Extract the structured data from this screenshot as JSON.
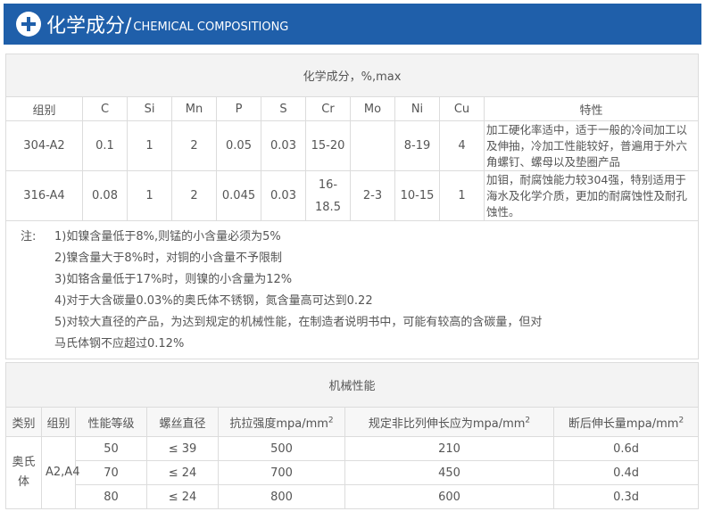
{
  "banner": {
    "title": "化学成分/",
    "subtitle": "CHEMICAL COMPOSITIONG"
  },
  "chemical": {
    "caption": "化学成分，%,max",
    "headers": [
      "组别",
      "C",
      "Si",
      "Mn",
      "P",
      "S",
      "Cr",
      "Mo",
      "Ni",
      "Cu",
      "特性"
    ],
    "rows": [
      {
        "group": "304-A2",
        "c": "0.1",
        "si": "1",
        "mn": "2",
        "p": "0.05",
        "s": "0.03",
        "cr": "15-20",
        "mo": "",
        "ni": "8-19",
        "cu": "4",
        "feature": "加工硬化率适中，适于一般的冷间加工以及伸抽，冷加工性能较好，普遍用于外六角螺钉、螺母以及垫圈产品"
      },
      {
        "group": "316-A4",
        "c": "0.08",
        "si": "1",
        "mn": "2",
        "p": "0.045",
        "s": "0.03",
        "cr_top": "16-",
        "cr_bottom": "18.5",
        "mo": "2-3",
        "ni": "10-15",
        "cu": "1",
        "feature": "加钼，耐腐蚀能力较304强，特别适用于海水及化学介质，更加的耐腐蚀性及耐孔蚀性。"
      }
    ],
    "notes_label": "注:",
    "notes": [
      "1)如镍含量低于8%,则锰的小含量必须为5%",
      "2)镍含量大于8%时，对铜的小含量不予限制",
      "3)如铬含量低于17%时，则镍的小含量为12%",
      "4)对于大含碳量0.03%的奥氏体不锈钢，氮含量高可达到0.22",
      "5)对较大直径的产品，为达到规定的机械性能，在制造者说明书中，可能有较高的含碳量，但对",
      "马氏体钢不应超过0.12%"
    ]
  },
  "mechanical": {
    "caption": "机械性能",
    "headers": {
      "category": "类别",
      "group": "组别",
      "grade": "性能等级",
      "diameter": "螺丝直径",
      "tensile": "抗拉强度mpa/mm",
      "yield": "规定非比列伸长应为mpa/mm",
      "elongation": "断后伸长量mpa/mm",
      "sup": "2"
    },
    "category": "奥氏体",
    "group": "A2,A4",
    "rows": [
      {
        "grade": "50",
        "diameter": "≤ 39",
        "tensile": "500",
        "yield": "210",
        "elongation": "0.6d"
      },
      {
        "grade": "70",
        "diameter": "≤ 24",
        "tensile": "700",
        "yield": "450",
        "elongation": "0.4d"
      },
      {
        "grade": "80",
        "diameter": "≤ 24",
        "tensile": "800",
        "yield": "600",
        "elongation": "0.3d"
      }
    ]
  },
  "colors": {
    "banner_bg": "#1f5faa",
    "caption_bg": "#f3f3f3",
    "border": "#dcdcdc"
  },
  "icons": {
    "banner_icon": "plus-circle-icon"
  }
}
